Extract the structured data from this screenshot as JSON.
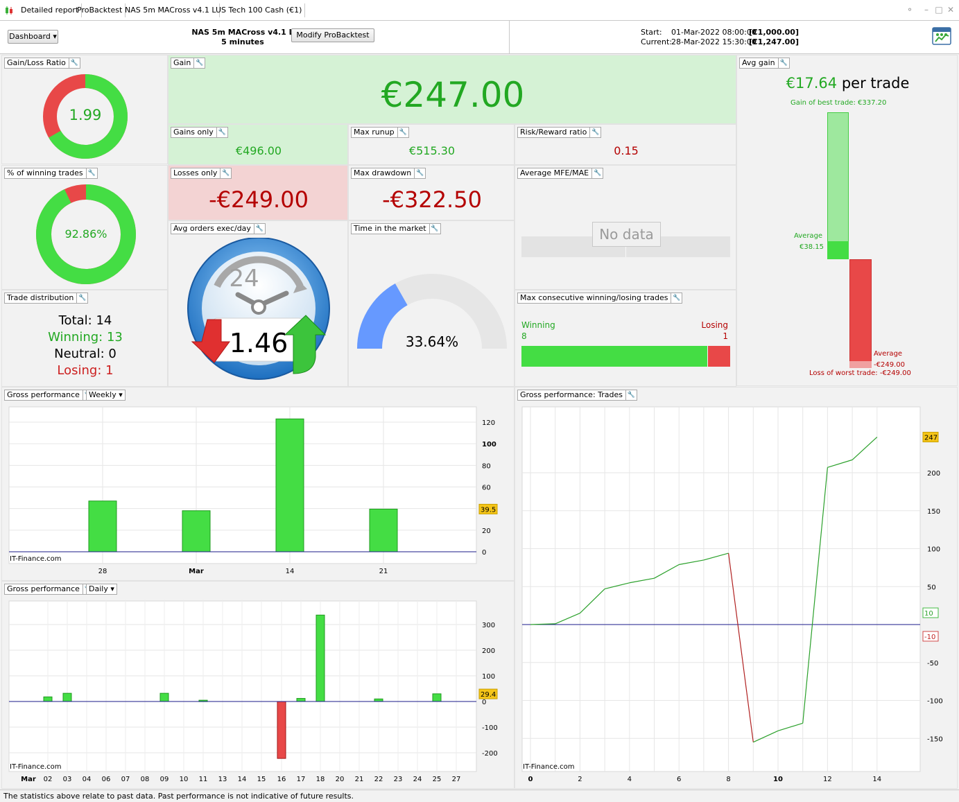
{
  "tabs": [
    {
      "label": "Detailed report"
    },
    {
      "label": "ProBacktest"
    },
    {
      "label": "NAS 5m MACross v4.1 L"
    },
    {
      "label": "US Tech 100 Cash (€1)"
    }
  ],
  "header": {
    "dashboard_label": "Dashboard",
    "strategy_name": "NAS 5m MACross v4.1 L",
    "timeframe": "5 minutes",
    "modify_button": "Modify ProBacktest",
    "start_label": "Start:",
    "start_date": "01-Mar-2022 08:00:00",
    "start_value": "[€1,000.00]",
    "current_label": "Current:",
    "current_date": "28-Mar-2022 15:30:00",
    "current_value": "[€1,247.00]"
  },
  "panels": {
    "gain_loss_ratio": {
      "title": "Gain/Loss Ratio",
      "value": "1.99",
      "fraction": 0.665
    },
    "gain": {
      "title": "Gain",
      "value": "€247.00"
    },
    "avg_gain": {
      "title": "Avg gain",
      "value": "€17.64",
      "suffix": "per trade",
      "best_trade": "Gain of best trade: €337.20",
      "avg_win_label": "Average",
      "avg_win_value": "€38.15",
      "avg_loss_label": "Average",
      "avg_loss_value": "-€249.00",
      "worst_trade": "Loss of worst trade: -€249.00"
    },
    "gains_only": {
      "title": "Gains only",
      "value": "€496.00"
    },
    "max_runup": {
      "title": "Max runup",
      "value": "€515.30"
    },
    "risk_reward": {
      "title": "Risk/Reward ratio",
      "value": "0.15"
    },
    "pct_winning": {
      "title": "% of winning trades",
      "value": "92.86%",
      "fraction": 0.9286
    },
    "losses_only": {
      "title": "Losses only",
      "value": "-€249.00"
    },
    "max_drawdown": {
      "title": "Max drawdown",
      "value": "-€322.50"
    },
    "avg_mfe_mae": {
      "title": "Average MFE/MAE",
      "no_data": "No data"
    },
    "avg_orders": {
      "title": "Avg orders exec/day",
      "value": "1.46",
      "clock_number": "24"
    },
    "time_in_market": {
      "title": "Time in the market",
      "value": "33.64%",
      "fraction": 0.3364
    },
    "trade_distribution": {
      "title": "Trade distribution",
      "total_label": "Total:",
      "total": "14",
      "winning_label": "Winning:",
      "winning": "13",
      "neutral_label": "Neutral:",
      "neutral": "0",
      "losing_label": "Losing:",
      "losing": "1"
    },
    "max_consecutive": {
      "title": "Max consecutive winning/losing trades",
      "winning_label": "Winning",
      "winning": "8",
      "losing_label": "Losing",
      "losing": "1"
    },
    "gross_weekly": {
      "title": "Gross performance",
      "period": "Weekly",
      "watermark": "IT-Finance.com"
    },
    "gross_daily": {
      "title": "Gross performance",
      "period": "Daily",
      "watermark": "IT-Finance.com"
    },
    "gross_trades": {
      "title": "Gross performance: Trades",
      "watermark": "IT-Finance.com"
    }
  },
  "chart_data": [
    {
      "type": "bar",
      "categories": [
        "28",
        "Mar",
        "14",
        "21"
      ],
      "values": [
        47,
        38,
        123,
        39.5
      ],
      "ylim": [
        0,
        130
      ],
      "yticks": [
        0,
        20,
        40,
        60,
        80,
        100,
        120
      ],
      "average_marker": "39.5"
    },
    {
      "type": "bar",
      "x_labels": [
        "Mar",
        "02",
        "03",
        "04",
        "06",
        "07",
        "08",
        "09",
        "10",
        "11",
        "13",
        "14",
        "15",
        "16",
        "17",
        "18",
        "20",
        "21",
        "22",
        "23",
        "24",
        "25",
        "27"
      ],
      "bars": [
        {
          "x": "02",
          "value": 18
        },
        {
          "x": "03",
          "value": 32
        },
        {
          "x": "09",
          "value": 32
        },
        {
          "x": "11",
          "value": 5
        },
        {
          "x": "16",
          "value": -222
        },
        {
          "x": "17",
          "value": 12
        },
        {
          "x": "18",
          "value": 337
        },
        {
          "x": "22",
          "value": 10
        },
        {
          "x": "25",
          "value": 30
        }
      ],
      "ylim": [
        -250,
        350
      ],
      "yticks": [
        -200,
        -100,
        0,
        100,
        200,
        300
      ],
      "average_marker": "29.4"
    },
    {
      "type": "line",
      "x": [
        0,
        1,
        2,
        3,
        4,
        5,
        6,
        7,
        8,
        9,
        10,
        11,
        12,
        13,
        14
      ],
      "y": [
        0,
        1,
        15,
        47,
        55,
        61,
        79,
        85,
        94,
        -155,
        -140,
        -130,
        207,
        217,
        247
      ],
      "xticks": [
        0,
        2,
        4,
        6,
        8,
        10,
        12,
        14
      ],
      "yticks": [
        -150,
        -100,
        -50,
        50,
        100,
        150,
        200
      ],
      "ylim": [
        -190,
        270
      ],
      "markers": [
        {
          "value": "247"
        },
        {
          "value": "10"
        },
        {
          "value": "-10"
        }
      ]
    }
  ],
  "footer": "The statistics above relate to past data. Past performance is not indicative of future results.",
  "colors": {
    "green": "#44dd44",
    "red": "#e84848",
    "gain_bg": "#d5f2d5",
    "loss_bg": "#f3d3d3",
    "blue": "#6699ff"
  }
}
